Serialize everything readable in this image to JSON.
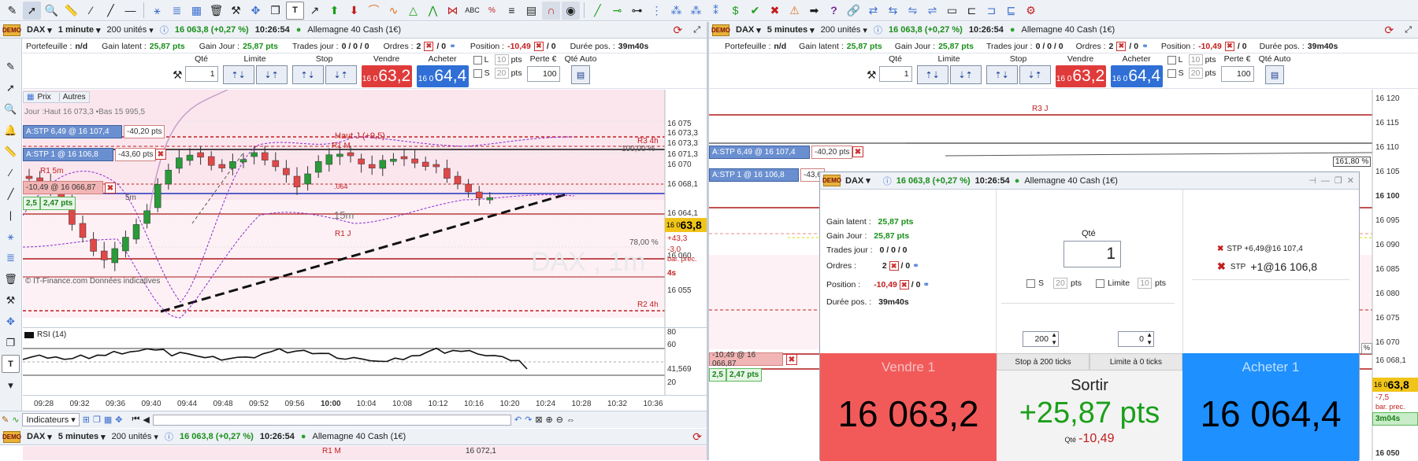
{
  "toolbar_icons": [
    "cursor-icon",
    "cross-cursor-icon",
    "zoom-icon",
    "ruler-icon",
    "pencil-icon",
    "line-icon",
    "horizontal-line-icon",
    "fibonacci-icon",
    "fan-icon",
    "grid-icon",
    "trash-icon",
    "magnet-icon",
    "move-icon",
    "text-icon",
    "arrow-icon",
    "arrow-up-icon",
    "arrow-down-icon",
    "pattern-icon",
    "channel-icon",
    "percent-icon",
    "chart-icon",
    "magnet2-icon",
    "eye-icon",
    "trend-icon",
    "segment-icon",
    "ray-icon",
    "dots-icon",
    "check-icon",
    "cross-icon",
    "warning-icon",
    "arrow-right-icon",
    "question-icon",
    "link-icon",
    "settings-icon"
  ],
  "left_window": {
    "instrument": "DAX",
    "timeframe": "1 minute",
    "units": "200 unités",
    "quote": "16 063,8 (+0,27 %)",
    "time": "10:26:54",
    "market": "Allemagne 40 Cash (1€)",
    "info": {
      "portefeuille_lbl": "Portefeuille :",
      "portefeuille": "n/d",
      "gain_latent_lbl": "Gain latent :",
      "gain_latent": "25,87 pts",
      "gain_jour_lbl": "Gain Jour :",
      "gain_jour": "25,87 pts",
      "trades_lbl": "Trades jour :",
      "trades": "0 / 0 / 0",
      "ordres_lbl": "Ordres :",
      "ordres": "2",
      "ordres2": "/ 0",
      "position_lbl": "Position :",
      "position": "-10,49",
      "duree_lbl": "Durée pos. :",
      "duree": "39m40s"
    },
    "order": {
      "qte_lbl": "Qté",
      "qte": "1",
      "limite_lbl": "Limite",
      "stop_lbl": "Stop",
      "vendre_lbl": "Vendre",
      "acheter_lbl": "Acheter",
      "sell_small": "16 0",
      "sell_big": "63,2",
      "buy_small": "16 0",
      "buy_big": "64,4",
      "l_lbl": "L",
      "s_lbl": "S",
      "pts10": "10",
      "pts20": "20",
      "pts": "pts",
      "perte_lbl": "Perte €",
      "perte": "100",
      "qte_auto_lbl": "Qté Auto"
    },
    "chart": {
      "tabs": [
        "Prix",
        "Autres"
      ],
      "jour_line": "Jour :Haut 16 073,3 •Bas 15 995,5",
      "stp_tags": [
        "A:STP 6,49 @ 16 107,4",
        "A:STP 1 @ 16 106,8"
      ],
      "pl_tags": [
        "-40,20 pts",
        "-43,60 pts"
      ],
      "pos_tag": "-10,49 @ 16 066,87",
      "green_tags": [
        "2,5",
        "2,47 pts"
      ],
      "annotations": [
        "Haut J (+9,5)",
        "R1 M",
        "R1 J",
        "R3 4h",
        "R2 4h",
        "R1 5m",
        "5m",
        "15m",
        ".064",
        "DAX , 1m"
      ],
      "pct_labels": [
        "100,00 %",
        "78,00 %"
      ],
      "y_labels": [
        "16 075",
        "16 073,3",
        "16 073,3",
        "16 071,3",
        "16 070",
        "16 068,1",
        "16 064,1",
        "16 060",
        "16 055"
      ],
      "price_badge_small": "16 0",
      "price_badge_big": "63,8",
      "side_vals": [
        "+43,3",
        "-3,0",
        "bar. prec.",
        "4s"
      ],
      "watermark": "© IT-Finance.com Données indicatives",
      "rsi_lbl": "RSI (14)",
      "rsi_y": [
        "80",
        "60",
        "41,569",
        "20"
      ],
      "x_labels": [
        "09:28",
        "09:32",
        "09:36",
        "09:40",
        "09:44",
        "09:48",
        "09:52",
        "09:56",
        "10:00",
        "10:04",
        "10:08",
        "10:12",
        "10:16",
        "10:20",
        "10:24",
        "10:28",
        "10:32",
        "10:36"
      ]
    },
    "bottom": {
      "indicators_lbl": "Indicateurs"
    }
  },
  "lower_window": {
    "instrument": "DAX",
    "timeframe": "5 minutes",
    "units": "200 unités",
    "quote": "16 063,8 (+0,27 %)",
    "time": "10:26:54",
    "market": "Allemagne 40 Cash (1€)",
    "labels": [
      "R1 M",
      "16 072,1"
    ]
  },
  "right_window": {
    "instrument": "DAX",
    "timeframe": "5 minutes",
    "units": "200 unités",
    "quote": "16 063,8 (+0,27 %)",
    "time": "10:26:54",
    "market": "Allemagne 40 Cash (1€)",
    "info": {
      "portefeuille_lbl": "Portefeuille :",
      "portefeuille": "n/d",
      "gain_latent_lbl": "Gain latent :",
      "gain_latent": "25,87 pts",
      "gain_jour_lbl": "Gain Jour :",
      "gain_jour": "25,87 pts",
      "trades_lbl": "Trades jour :",
      "trades": "0 / 0 / 0",
      "ordres_lbl": "Ordres :",
      "ordres": "2",
      "ordres2": "/ 0",
      "position_lbl": "Position :",
      "position": "-10,49",
      "duree_lbl": "Durée pos. :",
      "duree": "39m40s"
    },
    "chart": {
      "r3j": "R3 J",
      "stp_tags": [
        "A:STP 6,49 @ 16 107,4",
        "A:STP 1 @ 16 106,8"
      ],
      "pl_tags": [
        "-40,20 pts",
        "-43,6"
      ],
      "pos_tag": "-10,49 @ 16 066,87",
      "green_tags": [
        "2,5",
        "2,47 pts"
      ],
      "pct": "161,80 %",
      "y_labels": [
        "16 120",
        "16 115",
        "16 110",
        "16 105",
        "16 100",
        "16 095",
        "16 090",
        "16 085",
        "16 080",
        "16 075",
        "16 070",
        "16 068,1",
        "16 050"
      ],
      "side_vals": [
        "-7,5",
        "bar. prec.",
        "3m04s"
      ],
      "price_badge_small": "16 0",
      "price_badge_big": "63,8"
    }
  },
  "demo_panel": {
    "instrument": "DAX",
    "quote": "16 063,8 (+0,27 %)",
    "time": "10:26:54",
    "market": "Allemagne 40 Cash (1€)",
    "gain_latent_lbl": "Gain latent :",
    "gain_latent": "25,87 pts",
    "gain_jour_lbl": "Gain Jour :",
    "gain_jour": "25,87 pts",
    "trades_lbl": "Trades jour :",
    "trades": "0 / 0 / 0",
    "ordres_lbl": "Ordres :",
    "ordres": "2",
    "ordres2": "/ 0",
    "position_lbl": "Position :",
    "position": "-10,49",
    "position2": "/ 0",
    "duree_lbl": "Durée pos. :",
    "duree": "39m40s",
    "qte_lbl": "Qté",
    "qte": "1",
    "s_lbl": "S",
    "s_val": "20",
    "pts": "pts",
    "limite_lbl": "Limite",
    "limite_val": "10",
    "stepper1": "200",
    "stepper2": "0",
    "stp1": "STP   +6,49@16 107,4",
    "stp2_lbl": "STP",
    "stp2": "+1@16 106,8",
    "vendre_lbl": "Vendre 1",
    "vendre_price": "16 063,2",
    "stop_lbl": "Stop à 200 ticks",
    "limite_ticks_lbl": "Limite à 0 ticks",
    "sortir_lbl": "Sortir",
    "sortir_val": "+25,87 pts",
    "qte_bottom_lbl": "Qté",
    "qte_bottom": "-10,49",
    "acheter_lbl": "Acheter 1",
    "acheter_price": "16 064,4"
  }
}
